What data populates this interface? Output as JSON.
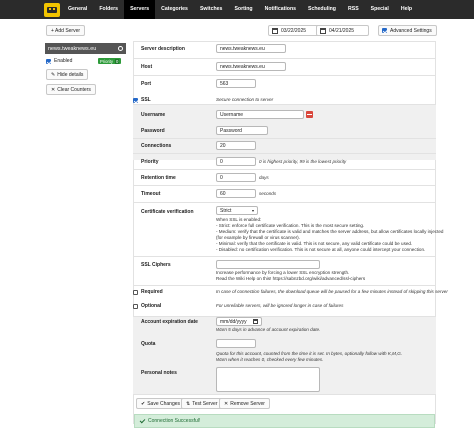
{
  "nav": {
    "items": [
      "General",
      "Folders",
      "Servers",
      "Categories",
      "Switches",
      "Sorting",
      "Notifications",
      "Scheduling",
      "RSS",
      "Special",
      "Help"
    ],
    "active": "Servers"
  },
  "toolbar": {
    "add_server": "+ Add Server",
    "date_from": "03/22/2025",
    "date_to": "04/21/2025",
    "date_sep": "-",
    "advanced_settings": "Advanced Settings"
  },
  "sidebar": {
    "server_name": "news.tweaknews.eu",
    "enabled_label": "Enabled",
    "priority_badge": "Priority",
    "priority_value": "0",
    "hide_details": "Hide details",
    "clear_counters": "Clear Counters"
  },
  "form": {
    "server_description": {
      "label": "Server description",
      "value": "news.tweaknews.eu"
    },
    "host": {
      "label": "Host",
      "value": "news.tweaknews.eu"
    },
    "port": {
      "label": "Port",
      "value": "563"
    },
    "ssl": {
      "label": "SSL",
      "hint": "Secure connection to server"
    },
    "username": {
      "label": "Username",
      "value": "Username"
    },
    "password": {
      "label": "Password",
      "value": "Password"
    },
    "connections": {
      "label": "Connections",
      "value": "20"
    },
    "priority": {
      "label": "Priority",
      "value": "0",
      "hint": "0 is highest priority, 99 is the lowest priority"
    },
    "retention": {
      "label": "Retention time",
      "value": "0",
      "hint": "days"
    },
    "timeout": {
      "label": "Timeout",
      "value": "60",
      "hint": "seconds"
    },
    "cert": {
      "label": "Certificate verification",
      "value": "Strict",
      "hint_lines": [
        "When SSL is enabled:",
        "- Strict: enforce full certificate verification. This is the most secure setting.",
        "- Medium: verify that the certificate is valid and matches the server address, but allow certificates locally injected",
        "(for example by firewall or virus scanner).",
        "- Minimal: verify that the certificate is valid. This is not secure, any valid certificate could be used.",
        "- Disabled: no certification verification. This is not secure at all, anyone could intercept your connection."
      ]
    },
    "ssl_ciphers": {
      "label": "SSL Ciphers",
      "hint_lines": [
        "Increase performance by forcing a lower SSL encryption strength.",
        "Read the Wiki Help on this! https://sabnzbd.org/wiki/advanced/ssl-ciphers"
      ]
    },
    "required": {
      "label": "Required",
      "hint": "In case of connection failures, the download queue will be paused for a few minutes instead of skipping this server"
    },
    "optional": {
      "label": "Optional",
      "hint": "For unreliable servers, will be ignored longer in case of failures"
    },
    "expiration": {
      "label": "Account expiration date",
      "value": "mm/dd/yyyy",
      "hint": "Warn 5 days in advance of account expiration date."
    },
    "quota": {
      "label": "Quota",
      "hint_lines": [
        "Quota for this account, counted from the time it is set. In bytes, optionally follow with K,M,G.",
        "Warn when it reaches 0, checked every few minutes."
      ]
    },
    "notes": {
      "label": "Personal notes"
    }
  },
  "actions": {
    "save": "Save Changes",
    "test": "Test Server",
    "remove": "Remove Server"
  },
  "status": {
    "message": "Connection Successful!"
  },
  "colors": {
    "nav_bg": "#2b2b2b",
    "accent": "#2468c8",
    "badge": "#2e9b3a",
    "success_bg": "#d4edda"
  }
}
